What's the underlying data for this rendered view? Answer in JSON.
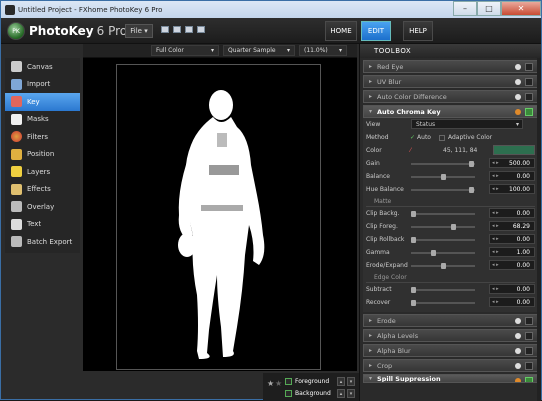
{
  "window": {
    "title": "Untitled Project - FXhome PhotoKey 6 Pro",
    "min": "–",
    "max": "□",
    "close": "✕"
  },
  "app": {
    "name": "PhotoKey",
    "version": "6 Pro",
    "logo_text": "PK"
  },
  "menu": {
    "file": "File ▾"
  },
  "nav": {
    "home": "HOME",
    "edit": "EDIT",
    "help": "HELP"
  },
  "sidebar": {
    "items": [
      {
        "label": "Canvas",
        "color": "#cccccc"
      },
      {
        "label": "Import",
        "color": "#7fa7d6"
      },
      {
        "label": "Key",
        "color": "#e2665c"
      },
      {
        "label": "Masks",
        "color": "#f0f0f0"
      },
      {
        "label": "Filters",
        "color": "#e0a040"
      },
      {
        "label": "Position",
        "color": "#e0b040"
      },
      {
        "label": "Layers",
        "color": "#f0d040"
      },
      {
        "label": "Effects",
        "color": "#e0c070"
      },
      {
        "label": "Overlay",
        "color": "#bbbbbb"
      },
      {
        "label": "Text",
        "color": "#dddddd"
      },
      {
        "label": "Batch Export",
        "color": "#bbbbbb"
      }
    ]
  },
  "viewbar": {
    "color_mode": "Full Color",
    "quality": "Quarter Sample",
    "zoom": "(11.0%)"
  },
  "layers": {
    "foreground": "Foreground",
    "background": "Background"
  },
  "toolbox": {
    "title": "TOOLBOX",
    "collapsed_top": [
      "Red Eye",
      "UV Blur",
      "Auto Color Difference"
    ],
    "chroma": {
      "title": "Auto Chroma Key",
      "view_label": "View",
      "view_value": "Status",
      "method_label": "Method",
      "method_auto": "Auto",
      "method_adaptive": "Adaptive Color",
      "color_label": "Color",
      "color_value": "45, 111, 84",
      "color_hex": "#2d6f54",
      "gain_label": "Gain",
      "gain_value": "500.00",
      "balance_label": "Balance",
      "balance_value": "0.00",
      "huebal_label": "Hue Balance",
      "huebal_value": "100.00",
      "matte_head": "Matte",
      "clipb_label": "Clip Backg.",
      "clipb_value": "0.00",
      "clipf_label": "Clip Foreg.",
      "clipf_value": "68.29",
      "cliproll_label": "Clip Rollback",
      "cliproll_value": "0.00",
      "gamma_label": "Gamma",
      "gamma_value": "1.00",
      "erode_label": "Erode/Expand",
      "erode_value": "0.00",
      "edge_head": "Edge Color",
      "subtract_label": "Subtract",
      "subtract_value": "0.00",
      "recover_label": "Recover",
      "recover_value": "0.00"
    },
    "collapsed_bottom": [
      "Erode",
      "Alpha Levels",
      "Alpha Blur",
      "Crop",
      "Spill Suppression"
    ]
  }
}
